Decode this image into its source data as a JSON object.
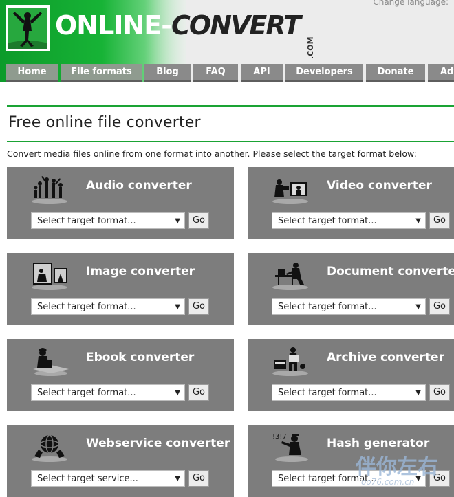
{
  "header": {
    "change_language": "Change language:",
    "logo_online": "ONLINE",
    "logo_dash": "-",
    "logo_convert": "CONVERT",
    "logo_com": ".COM"
  },
  "nav": {
    "items": [
      {
        "label": "Home",
        "active": true
      },
      {
        "label": "File formats",
        "active": true
      },
      {
        "label": "Blog",
        "active": false
      },
      {
        "label": "FAQ",
        "active": false
      },
      {
        "label": "API",
        "active": false
      },
      {
        "label": "Developers",
        "active": false
      },
      {
        "label": "Donate",
        "active": false
      },
      {
        "label": "Adv",
        "active": false
      }
    ]
  },
  "page": {
    "title": "Free online file converter",
    "intro": "Convert media files online from one format into another. Please select the target format below:"
  },
  "cards": [
    {
      "title": "Audio converter",
      "select": "Select target format...",
      "go": "Go",
      "icon": "audio-people-icon"
    },
    {
      "title": "Video converter",
      "select": "Select target format...",
      "go": "Go",
      "icon": "video-camera-icon"
    },
    {
      "title": "Image converter",
      "select": "Select target format...",
      "go": "Go",
      "icon": "image-frame-icon"
    },
    {
      "title": "Document converter",
      "select": "Select target format...",
      "go": "Go",
      "icon": "document-desk-icon"
    },
    {
      "title": "Ebook converter",
      "select": "Select target format...",
      "go": "Go",
      "icon": "ebook-reader-icon"
    },
    {
      "title": "Archive converter",
      "select": "Select target format...",
      "go": "Go",
      "icon": "archive-box-icon"
    },
    {
      "title": "Webservice converter",
      "select": "Select target service...",
      "go": "Go",
      "icon": "globe-hands-icon"
    },
    {
      "title": "Hash generator",
      "select": "Select target format...",
      "go": "Go",
      "icon": "hash-person-icon"
    }
  ],
  "watermark": {
    "text": "伴你左右",
    "sub": "oo76.com.cn"
  },
  "colors": {
    "brand_green": "#1aa334",
    "card_gray": "#7d7d7d",
    "nav_gray": "#8a8a8a"
  }
}
